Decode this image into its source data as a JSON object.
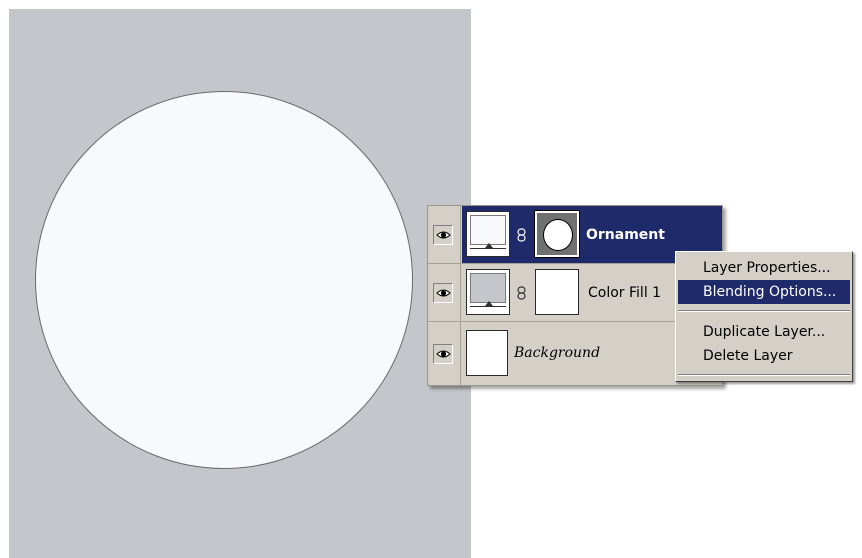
{
  "layers": [
    {
      "name": "Ornament",
      "selected": true,
      "thumb_color": "#f8f9fc",
      "has_mask": true
    },
    {
      "name": "Color Fill 1",
      "selected": false,
      "thumb_color": "#c5c6cb",
      "has_mask": true
    },
    {
      "name": "Background",
      "selected": false,
      "thumb_color": "#ffffff",
      "has_mask": false
    }
  ],
  "context_menu": {
    "items": [
      {
        "label": "Layer Properties..."
      },
      {
        "label": "Blending Options...",
        "highlighted": true
      },
      {
        "label": "Duplicate Layer..."
      },
      {
        "label": "Delete Layer"
      }
    ]
  },
  "colors": {
    "canvas_bg": "#c5c6cb",
    "ornament_fill": "#f8f9fc",
    "selection_bg": "#1f2a6b",
    "panel_bg": "#d4d0c8"
  }
}
